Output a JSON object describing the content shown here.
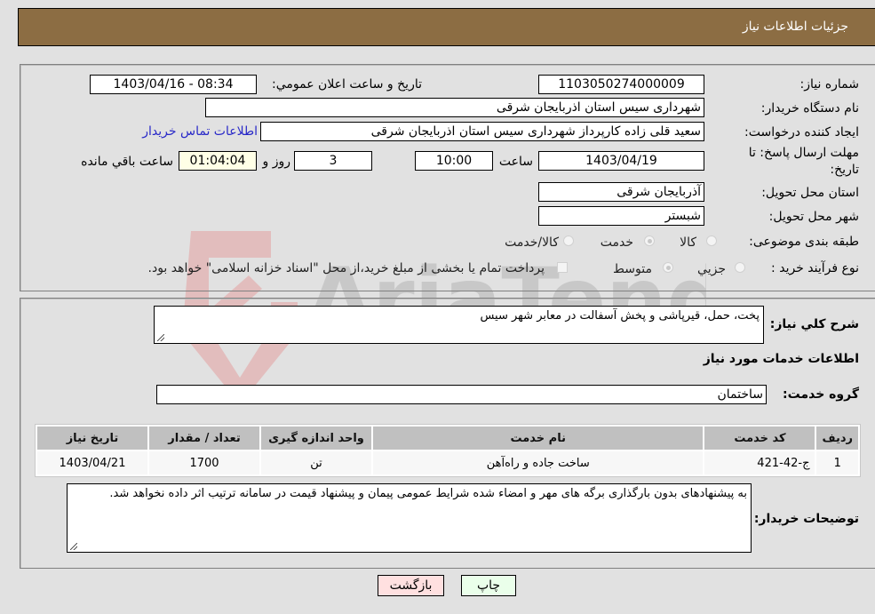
{
  "header": {
    "title": "جزئیات اطلاعات نیاز"
  },
  "fields": {
    "need_number": {
      "label": "شماره نیاز:",
      "value": "1103050274000009"
    },
    "announce_datetime": {
      "label": "تاریخ و ساعت اعلان عمومي:",
      "value": "1403/04/16 - 08:34"
    },
    "buyer_org": {
      "label": "نام دستگاه خریدار:",
      "value": "شهرداری سیس استان اذربایجان شرقی"
    },
    "requester": {
      "label": "ایجاد کننده درخواست:",
      "value": "سعید قلی زاده کارپرداز شهرداری سیس استان اذربایجان شرقی"
    },
    "buyer_contact_link": "اطلاعات تماس خریدار",
    "deadline": {
      "label": "مهلت ارسال پاسخ: تا تاریخ:",
      "date": "1403/04/19",
      "time_label": "ساعت",
      "time": "10:00",
      "days": "3",
      "days_label": "روز و",
      "remaining": "01:04:04",
      "remaining_label": "ساعت باقي مانده"
    },
    "delivery_province": {
      "label": "استان محل تحویل:",
      "value": "آذربایجان شرقی"
    },
    "delivery_city": {
      "label": "شهر محل تحویل:",
      "value": "شبستر"
    },
    "category": {
      "label": "طبقه بندی موضوعی:",
      "options": [
        "کالا",
        "خدمت",
        "کالا/خدمت"
      ],
      "selected": "خدمت"
    },
    "purchase_type": {
      "label": "نوع فرآیند خرید :",
      "options": [
        "جزيي",
        "متوسط"
      ],
      "selected": "متوسط",
      "treasury_note": "پرداخت تمام یا بخشی از مبلغ خرید،از محل \"اسناد خزانه اسلامی\" خواهد بود.",
      "treasury_checked": false
    }
  },
  "description": {
    "label": "شرح كلي نياز:",
    "value": "پخت، حمل، قیرپاشی و پخش آسفالت در معابر شهر سیس"
  },
  "services_section": {
    "title": "اطلاعات خدمات مورد نیاز"
  },
  "service_group": {
    "label": "گروه خدمت:",
    "value": "ساختمان"
  },
  "table": {
    "headers": [
      "ردیف",
      "کد خدمت",
      "نام خدمت",
      "واحد اندازه گیری",
      "تعداد / مقدار",
      "تاریخ نیاز"
    ],
    "rows": [
      [
        "1",
        "ج-42-421",
        "ساخت جاده و راه‌آهن",
        "تن",
        "1700",
        "1403/04/21"
      ]
    ]
  },
  "buyer_notes": {
    "label": "توضیحات خریدار:",
    "value": "به پیشنهادهای بدون بارگذاری برگه های مهر و امضاء شده شرایط عمومی پیمان و پیشنهاد قیمت در سامانه ترتیب اثر داده نخواهد شد."
  },
  "buttons": {
    "print": "چاپ",
    "back": "بازگشت"
  },
  "colors": {
    "header": "#8c6d43",
    "print_bg": "#eaffea",
    "back_bg": "#ffe0e0",
    "link": "#2828c8"
  },
  "watermark": "AriaTender.neT"
}
